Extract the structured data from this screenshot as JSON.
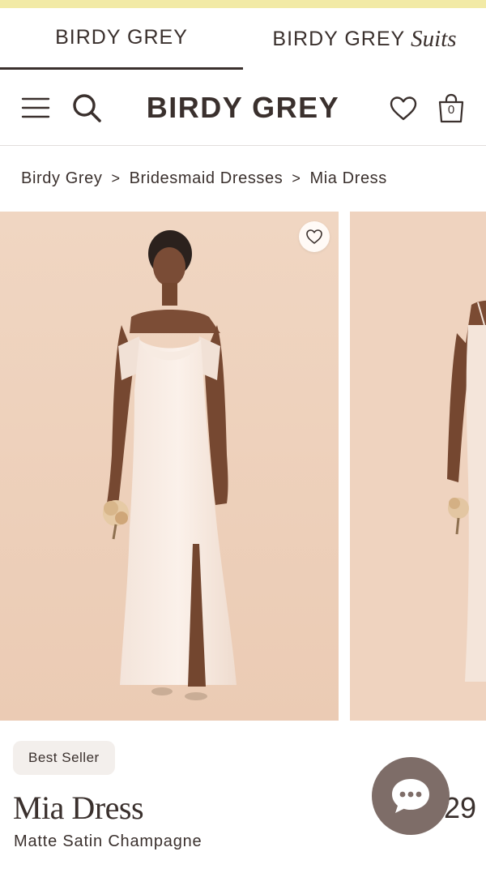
{
  "brand_tabs": [
    {
      "label": "BIRDY GREY",
      "active": true
    },
    {
      "label": "BIRDY GREY",
      "suffix": "Suits",
      "active": false
    }
  ],
  "header": {
    "logo": "BIRDY GREY",
    "cart_count": "0",
    "icons": [
      "menu-icon",
      "search-icon",
      "heart-icon",
      "shopping-bag-icon"
    ]
  },
  "breadcrumb": [
    "Birdy Grey",
    "Bridesmaid Dresses",
    "Mia Dress"
  ],
  "breadcrumb_separator": ">",
  "product": {
    "badge": "Best Seller",
    "title": "Mia Dress",
    "color": "Matte Satin Champagne",
    "price": "29"
  },
  "colors": {
    "promo_strip": "#f2eaa6",
    "text": "#3a302d",
    "photo_background": "#efd3be",
    "chat_button": "#7e6d68",
    "badge_background": "#f3efec"
  },
  "chat_icon": "chat-bubble-icon"
}
